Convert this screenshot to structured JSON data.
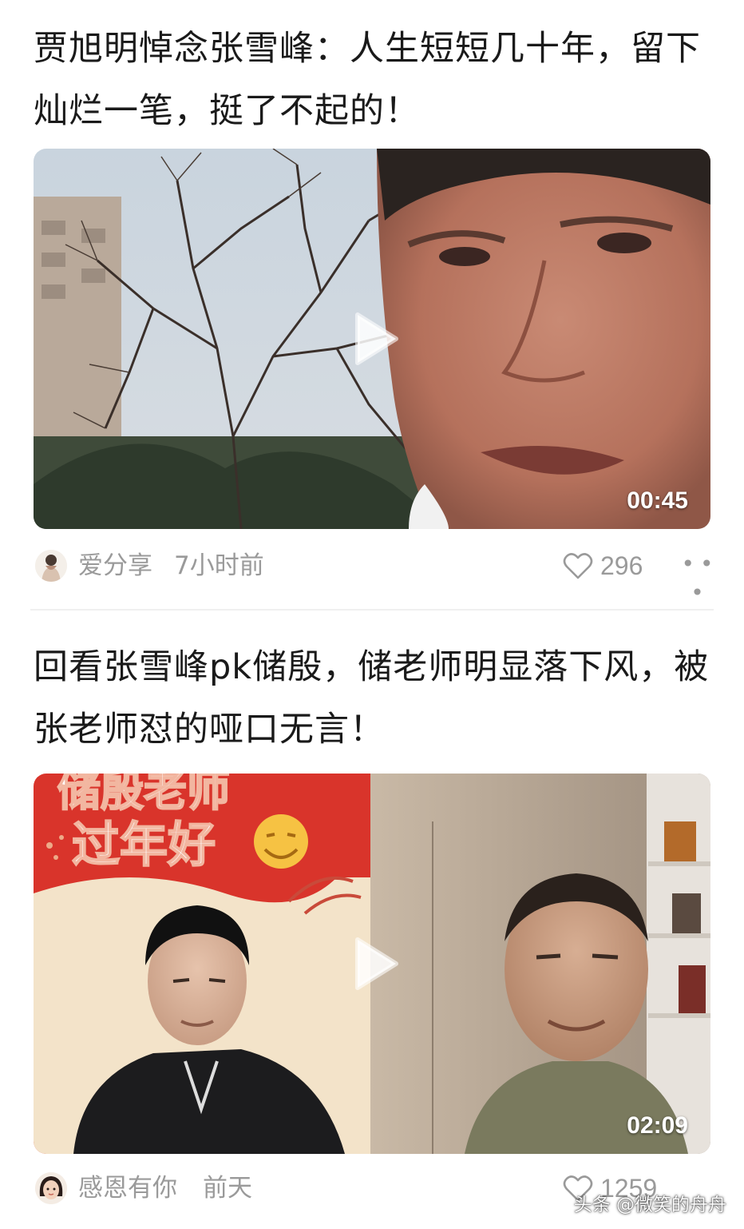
{
  "feed": {
    "items": [
      {
        "title": "贾旭明悼念张雪峰：人生短短几十年，留下灿烂一笔，挺了不起的！",
        "duration": "00:45",
        "author": "爱分享",
        "time": "7小时前",
        "likes": "296",
        "more_icon": "more-dots-icon",
        "play_icon": "play-icon"
      },
      {
        "title": "回看张雪峰pk储殷，储老师明显落下风，被张老师怼的哑口无言！",
        "duration": "02:09",
        "author": "感恩有你",
        "time": "前天",
        "likes": "1259",
        "overlay_text": "储殷老师过年好",
        "play_icon": "play-icon"
      }
    ]
  },
  "watermark": "头条 @微笑的舟舟",
  "colors": {
    "meta_text": "#9a9a9a",
    "title_text": "#1a1a1a",
    "banner_red": "#d9342b"
  }
}
